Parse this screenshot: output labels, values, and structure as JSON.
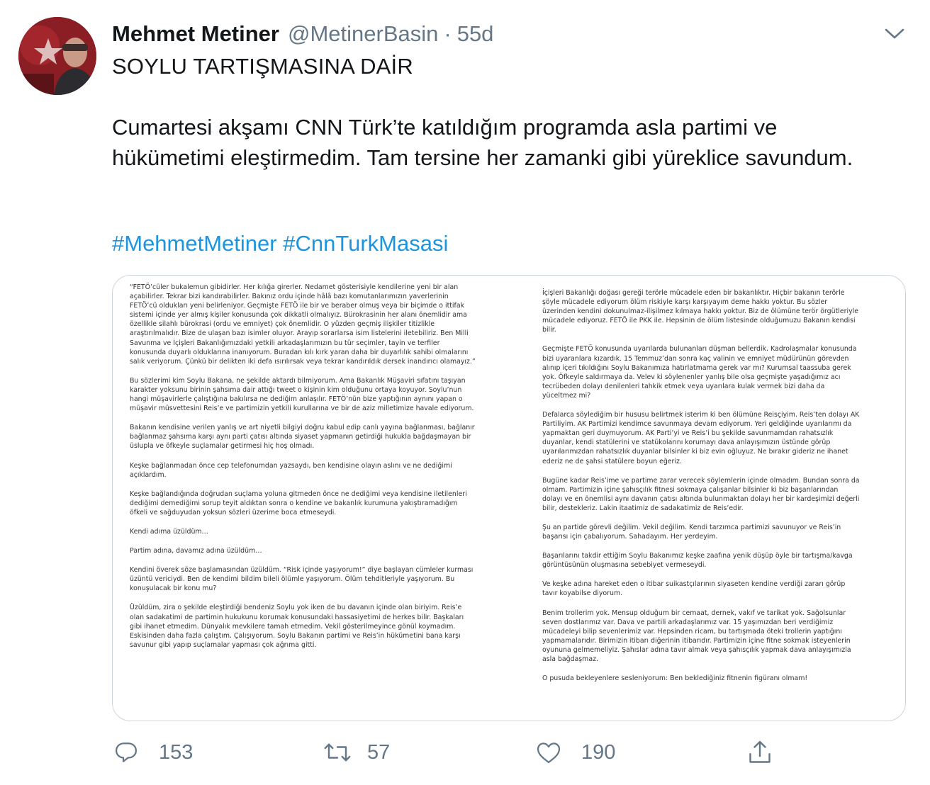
{
  "tweet": {
    "author_name": "Mehmet Metiner",
    "author_handle": "@MetinerBasin",
    "separator": "·",
    "time": "55d",
    "title": "SOYLU TARTIŞMASINA DAİR",
    "text": "Cumartesi akşamı CNN Türk’te katıldığım programda asla partimi ve hükümetimi eleştirmedim. Tam tersine her zamanki gibi yüreklice savundum.",
    "hashtags": [
      "#MehmetMetiner",
      "#CnnTurkMasasi"
    ]
  },
  "document": {
    "left": [
      "“FETÖ’cüler bukalemun gibidirler. Her kılığa girerler. Nedamet gösterisiyle kendilerine yeni bir alan açabilirler. Tekrar bizi kandırabilirler. Bakınız ordu içinde hâlâ bazı komutanlarımızın yaverlerinin FETÖ’cü oldukları yeni belirleniyor. Geçmişte FETÖ ile bir ve beraber olmuş veya bir biçimde o ittifak sistemi içinde yer almış kişiler konusunda çok dikkatli olmalıyız. Bürokrasinin her alanı önemlidir ama özellikle silahlı bürokrasi (ordu ve emniyet) çok önemlidir. O yüzden geçmiş ilişkiler titizlikle araştırılmalıdır.  Bize de ulaşan bazı isimler oluyor. Arayıp sorarlarsa isim listelerini iletebiliriz. Ben Milli Savunma ve İçişleri Bakanlığımızdaki yetkili arkadaşlarımızın bu tür seçimler, tayin ve terfiler konusunda duyarlı olduklarına inanıyorum. Buradan kılı kırk yaran daha bir duyarlılık sahibi olmalarını salık veriyorum. Çünkü bir delikten iki defa ısırılırsak veya tekrar kandırıldık dersek inandırıcı olamayız.”",
      "Bu sözlerimi kim Soylu Bakana, ne şekilde aktardı bilmiyorum. Ama Bakanlık Müşaviri sıfatını taşıyan karakter yoksunu birinin şahsıma dair attığı tweet o kişinin kim olduğunu ortaya koyuyor. Soylu’nun hangi müşavirlerle çalıştığına bakılırsa ne dediğim anlaşılır. FETÖ’nün bize yaptığının aynını yapan o müşavir müsvettesini Reis’e ve partimizin yetkili kurullarına ve bir de aziz milletimize havale ediyorum.",
      "Bakanın kendisine verilen yanlış ve art niyetli bilgiyi doğru kabul edip canlı yayına bağlanması, bağlanır bağlanmaz şahsıma karşı aynı parti çatısı altında siyaset yapmanın getirdiği hukukla bağdaşmayan bir üslupla ve öfkeyle suçlamalar getirmesi hiç hoş olmadı.",
      "Keşke bağlanmadan önce cep telefonumdan yazsaydı, ben kendisine olayın aslını ve ne dediğimi açıklardım.",
      "Keşke bağlandığında doğrudan suçlama yoluna gitmeden önce ne dediğimi veya kendisine iletilenleri dediğimi demediğimi sorup teyit aldıktan sonra o kendine ve bakanlık kurumuna yakıştıramadığım öfkeli ve sağduyudan yoksun sözleri üzerime boca etmeseydi.",
      "Kendi adıma üzüldüm…",
      "Partim adına, davamız adına üzüldüm…",
      "Kendini överek söze başlamasından üzüldüm. “Risk içinde yaşıyorum!” diye başlayan cümleler kurması üzüntü vericiydi. Ben de kendimi bildim bileli ölümle yaşıyorum. Ölüm tehditleriyle yaşıyorum. Bu konuşulacak bir konu mu?",
      "Üzüldüm, zira o şekilde eleştirdiği bendeniz Soylu yok iken de bu davanın içinde olan biriyim. Reis’e olan sadakatimi de partimin hukukunu korumak konusundaki hassasiyetimi de herkes bilir. Başkaları gibi ihanet etmedim. Dünyalık mevkilere tamah etmedim. Vekil gösterilmeyince gönül koymadım. Eskisinden daha fazla çalıştım. Çalışıyorum. Soylu Bakanın partimi ve Reis’in hükümetini bana karşı savunur gibi yapıp suçlamalar yapması çok ağrıma gitti."
    ],
    "right": [
      "İçişleri Bakanlığı doğası gereği terörle mücadele eden bir bakanlıktır. Hiçbir bakanın terörle şöyle mücadele ediyorum ölüm riskiyle karşı karşıyayım deme hakkı yoktur. Bu sözler üzerinden kendini dokunulmaz-ilişilmez kılmaya hakkı yoktur. Biz de ölümüne terör örgütleriyle mücadele ediyoruz. FETÖ ile PKK ile. Hepsinin de ölüm listesinde olduğumuzu Bakanın kendisi bilir.",
      "Geçmişte FETÖ konusunda uyarılarda bulunanları düşman bellerdik. Kadrolaşmalar konusunda bizi uyaranlara kızardık. 15 Temmuz’dan sonra kaç valinin ve emniyet müdürünün görevden alınıp içeri tıkıldığını Soylu Bakanımıza hatırlatmama gerek var mı? Kurumsal taassuba gerek yok. Öfkeyle saldırmaya da. Velev ki söylenenler yanlış bile olsa geçmişte yaşadığımız acı tecrübeden dolayı denilenleri tahkik etmek veya uyarılara kulak vermek bizi daha da yüceltmez mi?",
      "Defalarca söylediğim bir hususu belirtmek isterim ki ben ölümüne Reisçiyim. Reis’ten dolayı AK Partiliyim. AK Partimizi kendimce savunmaya devam ediyorum. Yeri geldiğinde uyarılarımı da yapmaktan geri duymuyorum. AK Parti’yi ve Reis’i bu şekilde savunmamdan rahatsızlık duyanlar, kendi statülerini ve statükolarını korumayı dava anlayışımızın üstünde görüp uyarılarımızdan rahatsızlık duyanlar bilsinler ki biz evin oğluyuz. Ne bırakır gideriz ne ihanet ederiz ne de şahsi statülere boyun eğeriz.",
      "Bugüne kadar Reis’ime ve partime zarar verecek söylemlerin içinde olmadım. Bundan sonra da olmam. Partimizin içine şahısçılık fitnesi sokmaya çalışanlar bilsinler ki biz başarılarından dolayı ve en önemlisi aynı davanın çatısı altında bulunmaktan dolayı her bir kardeşimizi değerli bilir, destekleriz. Lakin itaatimiz de sadakatimiz de Reis’edir.",
      "Şu an partide görevli değilim. Vekil değilim. Kendi tarzımca partimizi savunuyor ve Reis’in başarısı için çabalıyorum. Sahadayım. Her yerdeyim.",
      "Başarılarını takdir ettiğim Soylu Bakanımız keşke zaafına yenik düşüp öyle bir tartışma/kavga görüntüsünün oluşmasına sebebiyet vermeseydi.",
      "Ve keşke adına hareket eden o itibar suikastçılarının siyaseten kendine verdiği zararı görüp tavır koyabilse diyorum.",
      "Benim trollerim yok. Mensup olduğum bir cemaat, dernek, vakıf ve tarikat yok. Sağolsunlar seven dostlarımız var. Dava ve partili arkadaşlarımız var. 15 yaşımızdan beri verdiğimiz mücadeleyi bilip sevenlerimiz var. Hepsinden ricam, bu tartışmada öteki trollerin yaptığını yapmamalarıdır. Birimizin itibarı diğerinin itibarıdır. Partimizin içine fitne sokmak isteyenlerin oyununa gelmemeliyiz. Şahıslar adına tavır almak veya şahısçılık yapmak dava anlayışımızla asla bağdaşmaz.",
      "O pusuda bekleyenlere sesleniyorum: Ben beklediğiniz fitnenin figüranı olmam!"
    ]
  },
  "actions": {
    "replies": "153",
    "retweets": "57",
    "likes": "190"
  },
  "colors": {
    "text": "#14171a",
    "secondary": "#657786",
    "link": "#1b95e0",
    "border": "#ccd6dd"
  }
}
